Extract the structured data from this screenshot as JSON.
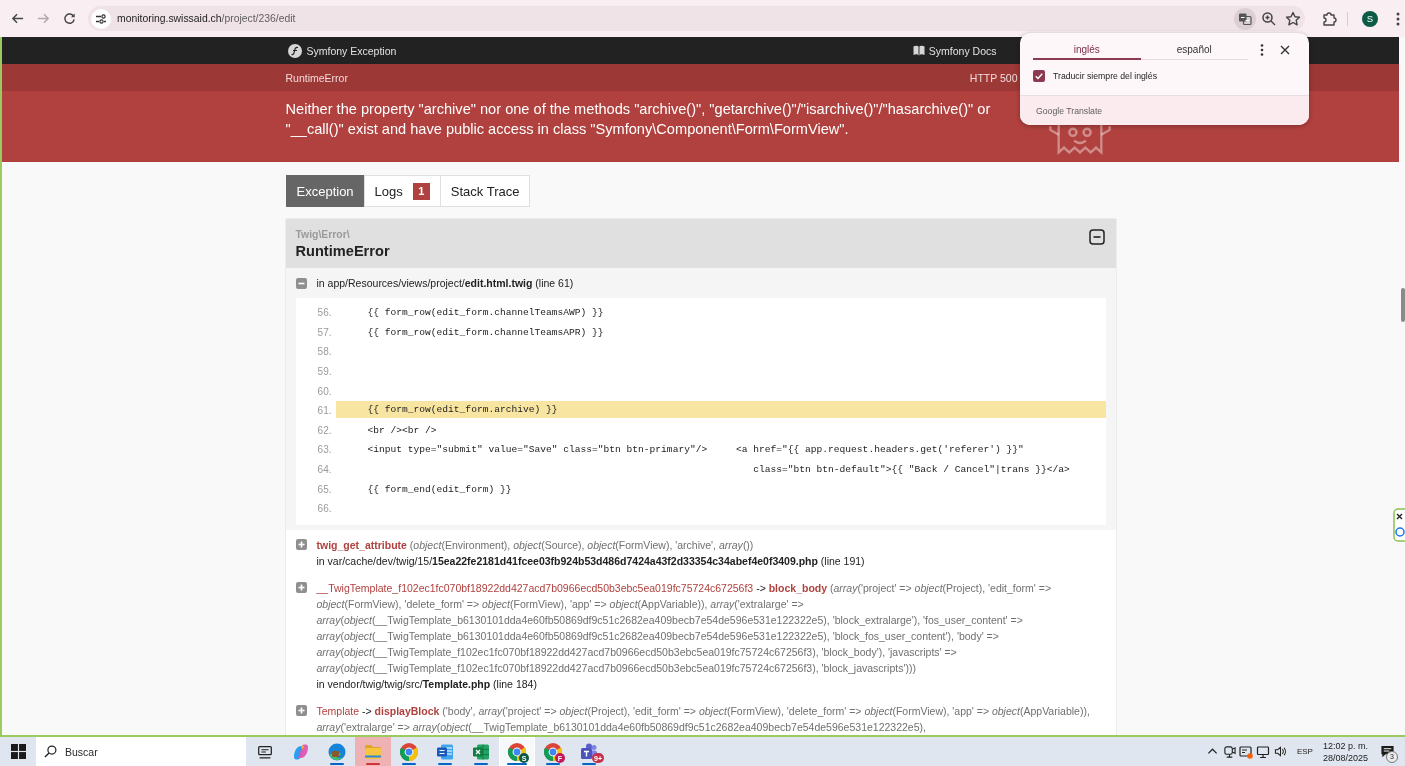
{
  "browser": {
    "forward_disabled": true,
    "url": {
      "host": "monitoring.swissaid.ch",
      "path": "/project/236/edit"
    },
    "translate_active": true,
    "profile_initial": "S"
  },
  "header": {
    "brand": "Symfony Exception",
    "links": [
      "Symfony Docs"
    ]
  },
  "metadata": {
    "class": "RuntimeError",
    "status": "HTTP 500"
  },
  "message": "Neither the property \"archive\" nor one of the methods \"archive()\", \"getarchive()\"/\"isarchive()\"/\"hasarchive()\" or \"__call()\" exist and have public access in class \"Symfony\\Component\\Form\\FormView\".",
  "tabs": [
    {
      "label": "Exception",
      "selected": true
    },
    {
      "label": "Logs",
      "selected": false,
      "badge": "1"
    },
    {
      "label": "Stack Trace",
      "selected": false
    }
  ],
  "exception": {
    "namespace": "Twig\\Error\\",
    "class": "RuntimeError",
    "expanded": true,
    "trace": [
      {
        "expanded": true,
        "file": "in app/Resources/views/project/**edit.html.twig** (line 61)",
        "code": [
          {
            "number": "56.",
            "code": "{{ form_row(edit_form.channelTeamsAWP) }}",
            "highlighted": false
          },
          {
            "number": "57.",
            "code": "{{ form_row(edit_form.channelTeamsAPR) }}",
            "highlighted": false
          },
          {
            "number": "58.",
            "highlighted": false
          },
          {
            "number": "59.",
            "highlighted": false
          },
          {
            "number": "60.",
            "highlighted": false
          },
          {
            "number": "61.",
            "code": "{{ form_row(edit_form.archive) }}",
            "highlighted": true
          },
          {
            "number": "62.",
            "code": "<br /><br />",
            "highlighted": false
          },
          {
            "number": "63.",
            "code": "<input type=\"submit\" value=\"Save\" class=\"btn btn-primary\"/>     <a href=\"{{ app.request.headers.get('referer') }}\"",
            "highlighted": false
          },
          {
            "number": "64.",
            "code": "                                                                   class=\"btn btn-default\">{{ \"Back / Cancel\"|trans }}</a>",
            "highlighted": false
          },
          {
            "number": "65.",
            "code": "{{ form_end(edit_form) }}",
            "highlighted": false
          },
          {
            "number": "66.",
            "highlighted": false
          }
        ]
      },
      {
        "expanded": false,
        "function": "twig_get_attribute",
        "args": "(*object*(Environment), *object*(Source), *object*(FormView), 'archive', *array*())",
        "file": "in var/cache/dev/twig/15/**15ea22fe2181d41fcee03fb924b53d486d7424a43f2d33354c34abef4e0f3409.php** (line 191)"
      },
      {
        "expanded": false,
        "class": "__TwigTemplate_f102ec1fc070bf18922dd427acd7b0966ecd50b3ebc5ea019fc75724c67256f3",
        "operator": "->",
        "function": "block_body",
        "args": "(*array*('project' => *object*(Project), 'edit_form' => *object*(FormView), 'delete_form' => *object*(FormView), 'app' => *object*(AppVariable)), *array*('extralarge' => *array*(*object*(__TwigTemplate_b6130101dda4e60fb50869df9c51c2682ea409becb7e54de596e531e122322e5), 'block_extralarge'), 'fos_user_content' => *array*(*object*(__TwigTemplate_b6130101dda4e60fb50869df9c51c2682ea409becb7e54de596e531e122322e5), 'block_fos_user_content'), 'body' => *array*(*object*(__TwigTemplate_f102ec1fc070bf18922dd427acd7b0966ecd50b3ebc5ea019fc75724c67256f3), 'block_body'), 'javascripts' => *array*(*object*(__TwigTemplate_f102ec1fc070bf18922dd427acd7b0966ecd50b3ebc5ea019fc75724c67256f3), 'block_javascripts')))",
        "file": "in vendor/twig/twig/src/**Template.php** (line 184)"
      },
      {
        "expanded": false,
        "class": "Template",
        "operator": "->",
        "function": "displayBlock",
        "args": "('body', *array*('project' => *object*(Project), 'edit_form' => *object*(FormView), 'delete_form' => *object*(FormView), 'app' => *object*(AppVariable)), *array*('extralarge' => *array*(*object*(__TwigTemplate_b6130101dda4e60fb50869df9c51c2682ea409becb7e54de596e531e122322e5),"
      }
    ]
  },
  "translate_popup": {
    "tabs": [
      {
        "label": "inglés",
        "selected": true
      },
      {
        "label": "español",
        "selected": false
      }
    ],
    "always_translate": {
      "label": "Traducir siempre del inglés",
      "checked": true
    },
    "footer": "Google Translate"
  },
  "taskbar": {
    "search": {
      "placeholder": "Buscar"
    },
    "apps": [
      {
        "kind": "taskview",
        "running": false,
        "selected": false,
        "attention": false
      },
      {
        "kind": "copilot",
        "running": false,
        "selected": false,
        "attention": false
      },
      {
        "kind": "edge",
        "running": true,
        "selected": false,
        "attention": false
      },
      {
        "kind": "explorer",
        "running": true,
        "selected": false,
        "attention": true
      },
      {
        "kind": "chrome",
        "running": true,
        "selected": false,
        "attention": false
      },
      {
        "kind": "word",
        "running": true,
        "selected": false,
        "attention": false
      },
      {
        "kind": "excel",
        "running": true,
        "selected": false,
        "attention": false
      },
      {
        "kind": "chrome",
        "badge": "S",
        "color": "#0d5b46",
        "running": true,
        "selected": true,
        "attention": false
      },
      {
        "kind": "chrome",
        "badge": "F",
        "color": "#c2185b",
        "running": true,
        "selected": false,
        "attention": false
      },
      {
        "kind": "teams",
        "badge": "9+",
        "color": "#c4314b",
        "running": true,
        "selected": false,
        "attention": false
      }
    ],
    "tray": {
      "language": "ESP",
      "time": "12:02 p. m.",
      "date": "28/08/2025",
      "notifications": "3"
    }
  }
}
